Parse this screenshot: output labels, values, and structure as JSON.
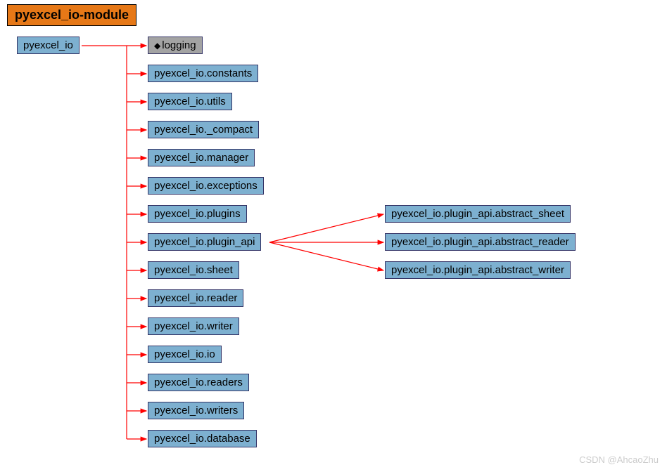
{
  "title": "pyexcel_io-module",
  "root": "pyexcel_io",
  "logging_item": "logging",
  "children": [
    "pyexcel_io.constants",
    "pyexcel_io.utils",
    "pyexcel_io._compact",
    "pyexcel_io.manager",
    "pyexcel_io.exceptions",
    "pyexcel_io.plugins",
    "pyexcel_io.plugin_api",
    "pyexcel_io.sheet",
    "pyexcel_io.reader",
    "pyexcel_io.writer",
    "pyexcel_io.io",
    "pyexcel_io.readers",
    "pyexcel_io.writers",
    "pyexcel_io.database"
  ],
  "plugin_api_children": [
    "pyexcel_io.plugin_api.abstract_sheet",
    "pyexcel_io.plugin_api.abstract_reader",
    "pyexcel_io.plugin_api.abstract_writer"
  ],
  "watermark": "CSDN @AhcaoZhu"
}
